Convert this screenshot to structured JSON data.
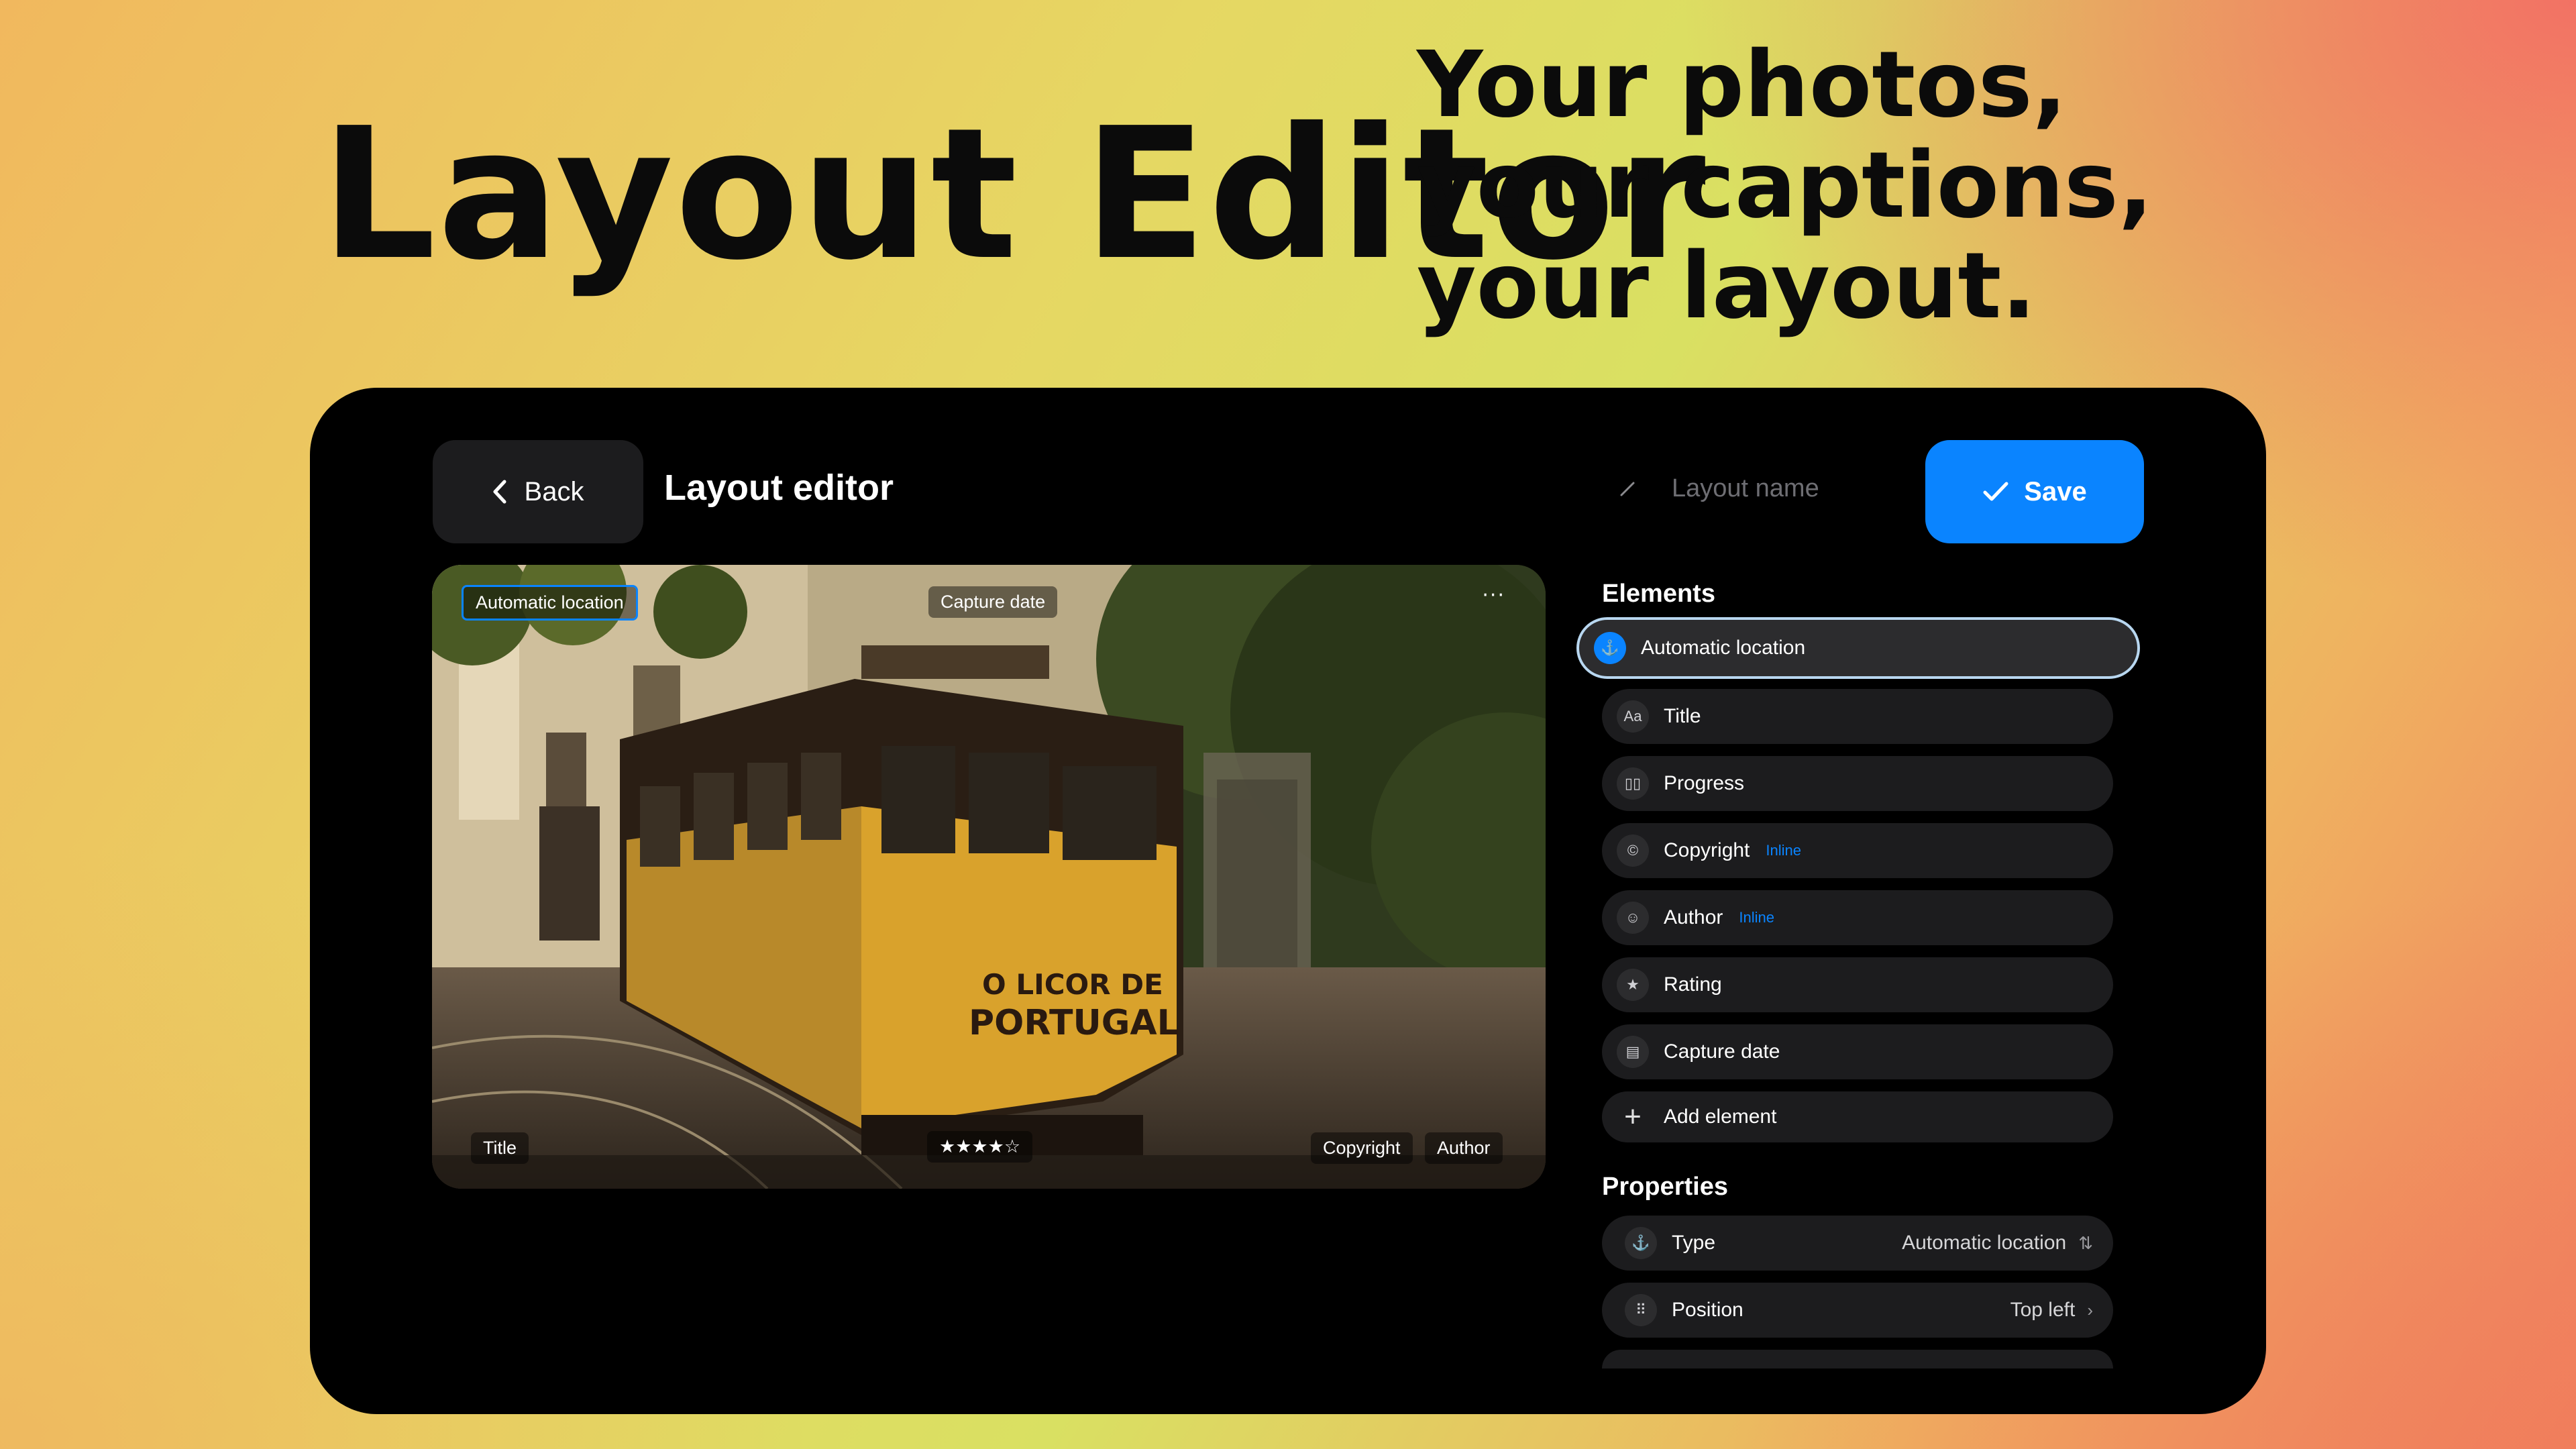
{
  "hero": {
    "title": "Layout Editor",
    "tagline": [
      "Your photos,",
      "your captions,",
      "your layout."
    ]
  },
  "header": {
    "back_label": "Back",
    "title": "Layout editor",
    "layout_name_placeholder": "Layout name",
    "save_label": "Save"
  },
  "photo_overlay": {
    "automatic_location": "Automatic location",
    "capture_date": "Capture date",
    "title": "Title",
    "rating": "★★★★☆",
    "copyright": "Copyright",
    "author": "Author",
    "more": "···"
  },
  "elements": {
    "heading": "Elements",
    "items": [
      {
        "label": "Automatic location",
        "icon": "location-pin-icon",
        "selected": true
      },
      {
        "label": "Title",
        "icon": "text-aa-icon"
      },
      {
        "label": "Progress",
        "icon": "progress-bars-icon"
      },
      {
        "label": "Copyright",
        "icon": "copyright-icon",
        "badge": "Inline"
      },
      {
        "label": "Author",
        "icon": "person-circle-icon",
        "badge": "Inline"
      },
      {
        "label": "Rating",
        "icon": "star-icon"
      },
      {
        "label": "Capture date",
        "icon": "calendar-icon"
      }
    ],
    "add_label": "Add element"
  },
  "properties": {
    "heading": "Properties",
    "items": [
      {
        "label": "Type",
        "value": "Automatic location",
        "icon": "location-pin-icon"
      },
      {
        "label": "Position",
        "value": "Top left",
        "icon": "grid-dots-icon"
      }
    ]
  },
  "colors": {
    "accent": "#0a84ff",
    "panel": "#1c1c1e",
    "device": "#000000"
  }
}
